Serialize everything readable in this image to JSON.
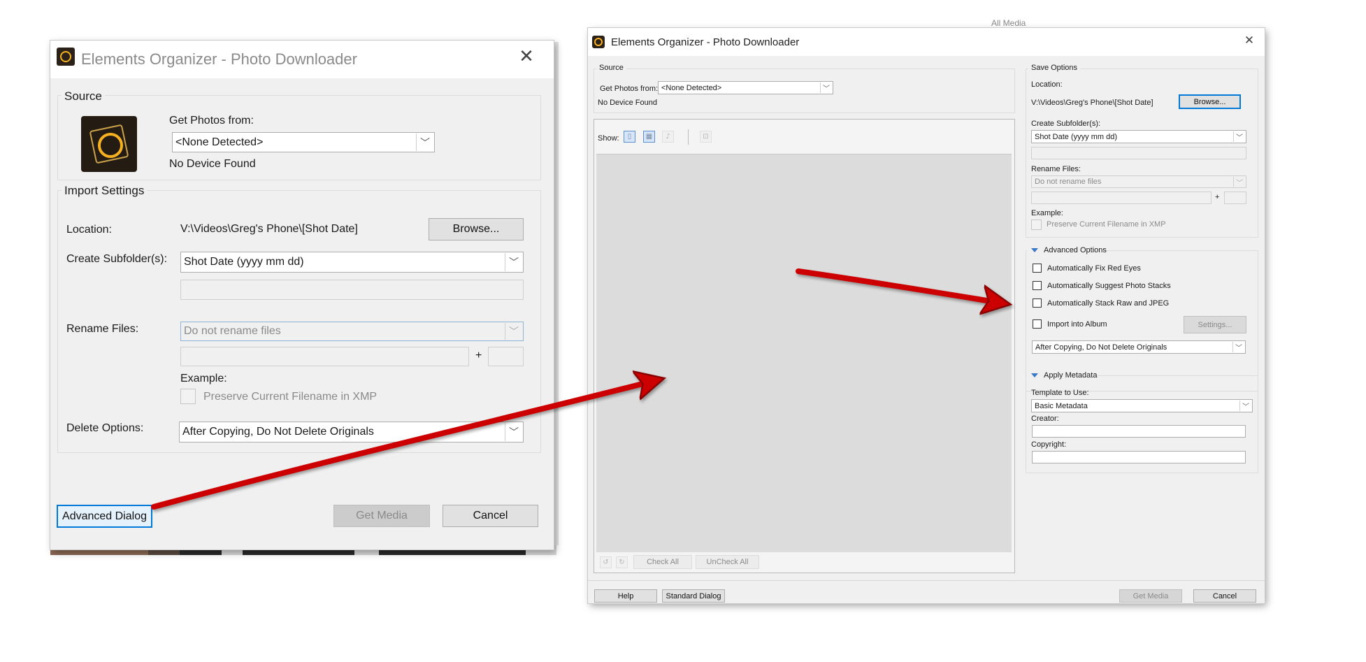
{
  "standard_dialog": {
    "title": "Elements Organizer - Photo Downloader",
    "source_label": "Source",
    "get_photos_label": "Get Photos from:",
    "get_photos_value": "<None Detected>",
    "no_device": "No Device Found",
    "import_settings_label": "Import Settings",
    "location_label": "Location:",
    "location_value": "V:\\Videos\\Greg's Phone\\[Shot Date]",
    "browse": "Browse...",
    "subfolder_label": "Create Subfolder(s):",
    "subfolder_value": "Shot Date (yyyy mm dd)",
    "rename_label": "Rename Files:",
    "rename_value": "Do not rename files",
    "plus": "+",
    "example_label": "Example:",
    "preserve_label": "Preserve Current Filename in XMP",
    "delete_label": "Delete Options:",
    "delete_value": "After Copying, Do Not Delete Originals",
    "advanced_dialog": "Advanced Dialog",
    "get_media": "Get Media",
    "cancel": "Cancel"
  },
  "advanced_dialog": {
    "title": "Elements Organizer - Photo Downloader",
    "behind_text": "All Media",
    "source_label": "Source",
    "get_photos_label": "Get Photos from:",
    "get_photos_value": "<None Detected>",
    "no_device": "No Device Found",
    "show_label": "Show:",
    "check_all": "Check All",
    "uncheck_all": "UnCheck All",
    "save_options_label": "Save Options",
    "location_label": "Location:",
    "location_value": "V:\\Videos\\Greg's Phone\\[Shot Date]",
    "browse": "Browse...",
    "subfolder_label": "Create Subfolder(s):",
    "subfolder_value": "Shot Date (yyyy mm dd)",
    "rename_label": "Rename Files:",
    "rename_value": "Do not rename files",
    "plus": "+",
    "example_label": "Example:",
    "preserve_label": "Preserve Current Filename in XMP",
    "advanced_options_label": "Advanced Options",
    "fix_red_eyes": "Automatically Fix Red Eyes",
    "suggest_stacks": "Automatically Suggest Photo Stacks",
    "stack_raw_jpeg": "Automatically Stack Raw and JPEG",
    "import_album": "Import into Album",
    "settings": "Settings...",
    "delete_value": "After Copying, Do Not Delete Originals",
    "apply_metadata_label": "Apply Metadata",
    "template_label": "Template to Use:",
    "template_value": "Basic Metadata",
    "creator_label": "Creator:",
    "copyright_label": "Copyright:",
    "help": "Help",
    "standard_dialog": "Standard Dialog",
    "get_media": "Get Media",
    "cancel": "Cancel"
  },
  "colors": {
    "arrow_red": "#cc0000",
    "focus_blue": "#0078d7",
    "dialog_bg": "#f0f0f0"
  }
}
